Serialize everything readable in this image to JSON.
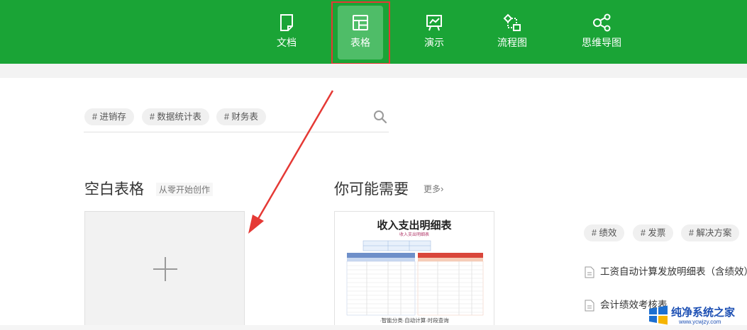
{
  "nav": {
    "items": [
      {
        "label": "文档",
        "icon": "document-icon"
      },
      {
        "label": "表格",
        "icon": "table-icon",
        "active": true
      },
      {
        "label": "演示",
        "icon": "presentation-icon"
      },
      {
        "label": "流程图",
        "icon": "flowchart-icon"
      },
      {
        "label": "思维导图",
        "icon": "mindmap-icon"
      }
    ]
  },
  "search": {
    "tags": [
      "# 进销存",
      "# 数据统计表",
      "# 财务表"
    ],
    "icon": "search-icon"
  },
  "blank": {
    "title": "空白表格",
    "subtitle": "从零开始创作"
  },
  "recommend": {
    "title": "你可能需要",
    "more": "更多",
    "card": {
      "title": "收入支出明细表",
      "subtitle": "收入支出明细表",
      "footer": "·智能分类·自动计算·时段查询"
    }
  },
  "side": {
    "tags": [
      "# 绩效",
      "# 发票",
      "# 解决方案"
    ],
    "files": [
      "工资自动计算发放明细表（含绩效）",
      "会计绩效考核表"
    ]
  },
  "watermark": {
    "text": "纯净系统之家",
    "url": "www.ycwjzy.com"
  },
  "colors": {
    "brand_green": "#1aa436",
    "active_tab": "#4fbd68",
    "highlight_red": "#e53935"
  }
}
